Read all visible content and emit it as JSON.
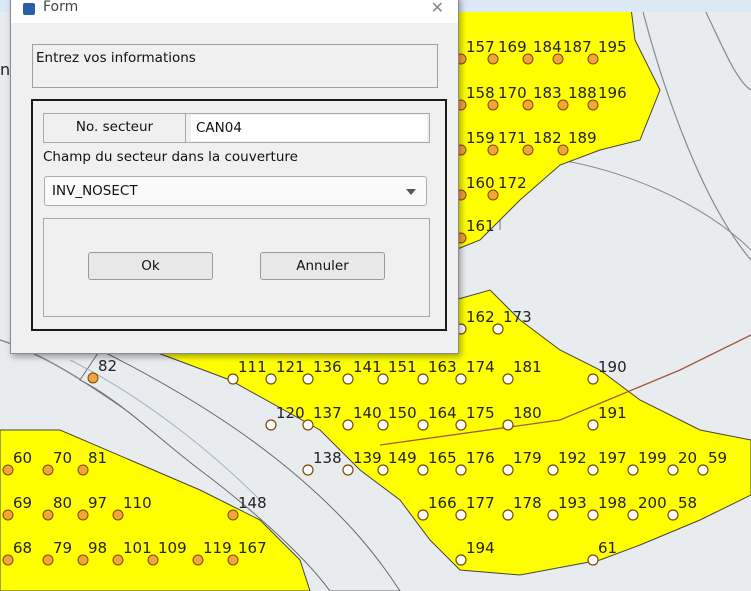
{
  "dialog": {
    "title": "Form",
    "info_label": "Entrez vos informations",
    "sector_label": "No. secteur",
    "sector_value": "CAN04",
    "field_label": "Champ du secteur dans la couverture",
    "field_value": "INV_NOSECT",
    "ok_label": "Ok",
    "cancel_label": "Annuler"
  },
  "side_label": "n",
  "map": {
    "polygon_color": "#ffff00",
    "point_fill": "#f5a43a",
    "point_open_fill": "#ffffff",
    "labels": [
      "157",
      "169",
      "184",
      "187",
      "195",
      "158",
      "170",
      "183",
      "188",
      "196",
      "159",
      "171",
      "182",
      "189",
      "160",
      "172",
      "161",
      "162",
      "173",
      "82",
      "111",
      "121",
      "136",
      "141",
      "151",
      "163",
      "174",
      "181",
      "190",
      "120",
      "137",
      "140",
      "150",
      "164",
      "175",
      "180",
      "191",
      "60",
      "70",
      "81",
      "138",
      "139",
      "149",
      "165",
      "176",
      "179",
      "192",
      "197",
      "199",
      "20",
      "59",
      "69",
      "80",
      "97",
      "110",
      "148",
      "166",
      "177",
      "178",
      "193",
      "198",
      "200",
      "58",
      "68",
      "79",
      "98",
      "101",
      "109",
      "119",
      "167",
      "194",
      "61"
    ]
  }
}
